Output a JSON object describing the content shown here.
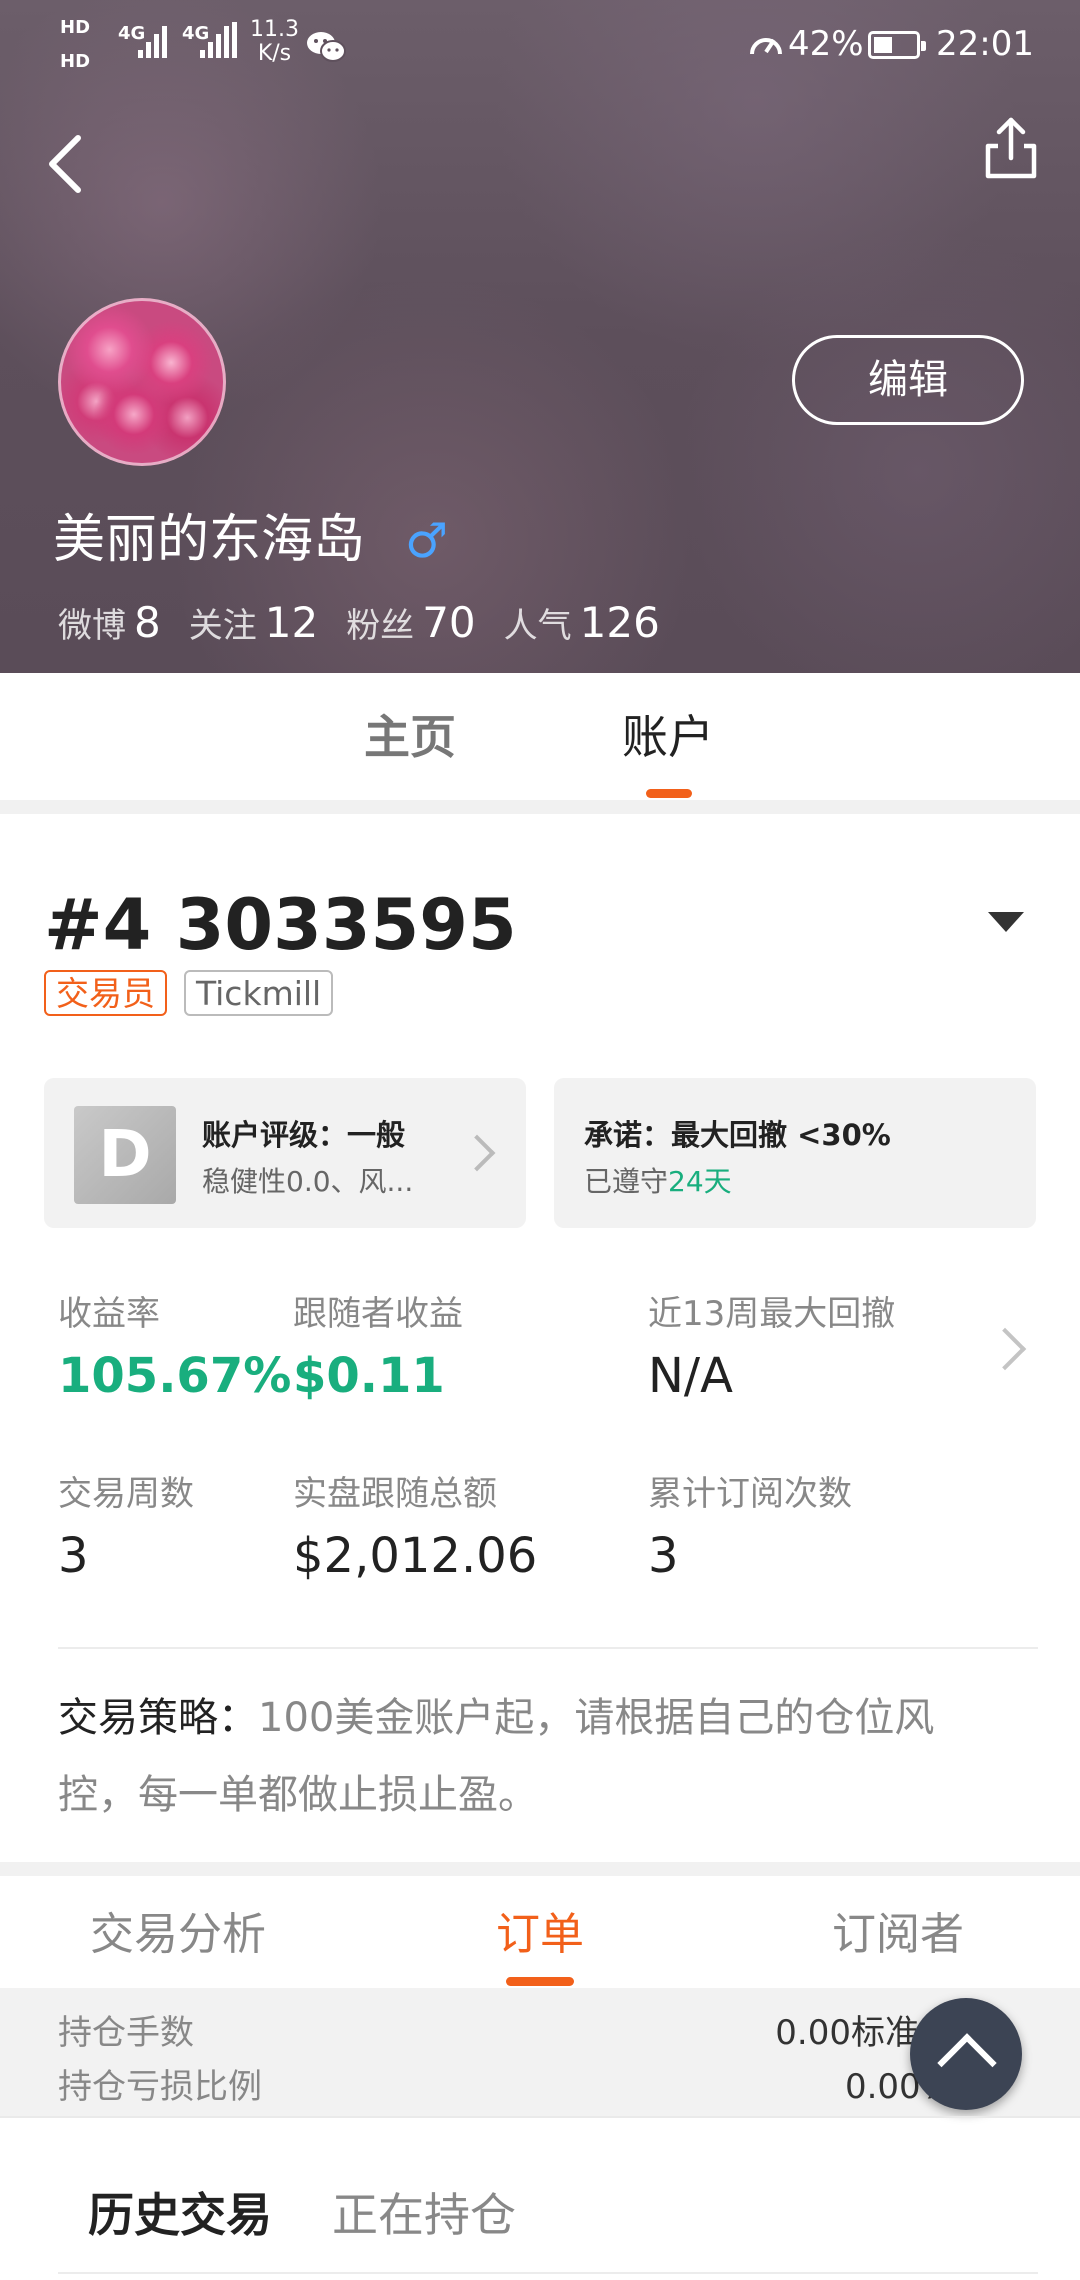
{
  "status_bar": {
    "net_speed_value": "11.3",
    "net_speed_unit": "K/s",
    "battery_percent": "42%",
    "time": "22:01",
    "signal_labels": [
      "HD",
      "HD",
      "4G",
      "4G"
    ]
  },
  "header": {
    "back_icon": "chevron-left-icon",
    "share_icon": "share-icon",
    "edit_label": "编辑",
    "user_name": "美丽的东海岛",
    "gender_symbol": "♂",
    "stats": [
      {
        "label": "微博",
        "value": "8"
      },
      {
        "label": "关注",
        "value": "12"
      },
      {
        "label": "粉丝",
        "value": "70"
      },
      {
        "label": "人气",
        "value": "126"
      }
    ]
  },
  "top_tabs": [
    {
      "label": "主页",
      "active": false
    },
    {
      "label": "账户",
      "active": true
    }
  ],
  "account": {
    "title": "#4 3033595",
    "badges": [
      "交易员",
      "Tickmill"
    ],
    "rating": {
      "grade": "D",
      "title": "账户评级：一般",
      "subtitle": "稳健性0.0、风..."
    },
    "promise": {
      "title": "承诺：最大回撤 <30%",
      "prefix": "已遵守",
      "days": "24天"
    },
    "metrics": [
      {
        "label": "收益率",
        "value": "105.67%"
      },
      {
        "label": "跟随者收益",
        "value": "$0.11"
      },
      {
        "label": "近13周最大回撤",
        "value": "N/A"
      },
      {
        "label": "交易周数",
        "value": "3"
      },
      {
        "label": "实盘跟随总额",
        "value": "$2,012.06"
      },
      {
        "label": "累计订阅次数",
        "value": "3"
      }
    ],
    "strategy_label": "交易策略：",
    "strategy_line1": "100美金账户起，请根据自己的仓位风",
    "strategy_line2": "控，每一单都做止损止盈。"
  },
  "sub_tabs": [
    {
      "label": "交易分析",
      "active": false
    },
    {
      "label": "订单",
      "active": true
    },
    {
      "label": "订阅者",
      "active": false
    }
  ],
  "summary": {
    "rows": [
      {
        "label": "持仓手数",
        "value": "0.00标准手"
      },
      {
        "label": "持仓亏损比例",
        "value": "0.00%"
      }
    ]
  },
  "history_tabs": [
    {
      "label": "历史交易",
      "active": true
    },
    {
      "label": "正在持仓",
      "active": false
    }
  ],
  "colors": {
    "accent": "#f2601a",
    "green": "#19ae7e",
    "gender_blue": "#4aa3ff"
  }
}
